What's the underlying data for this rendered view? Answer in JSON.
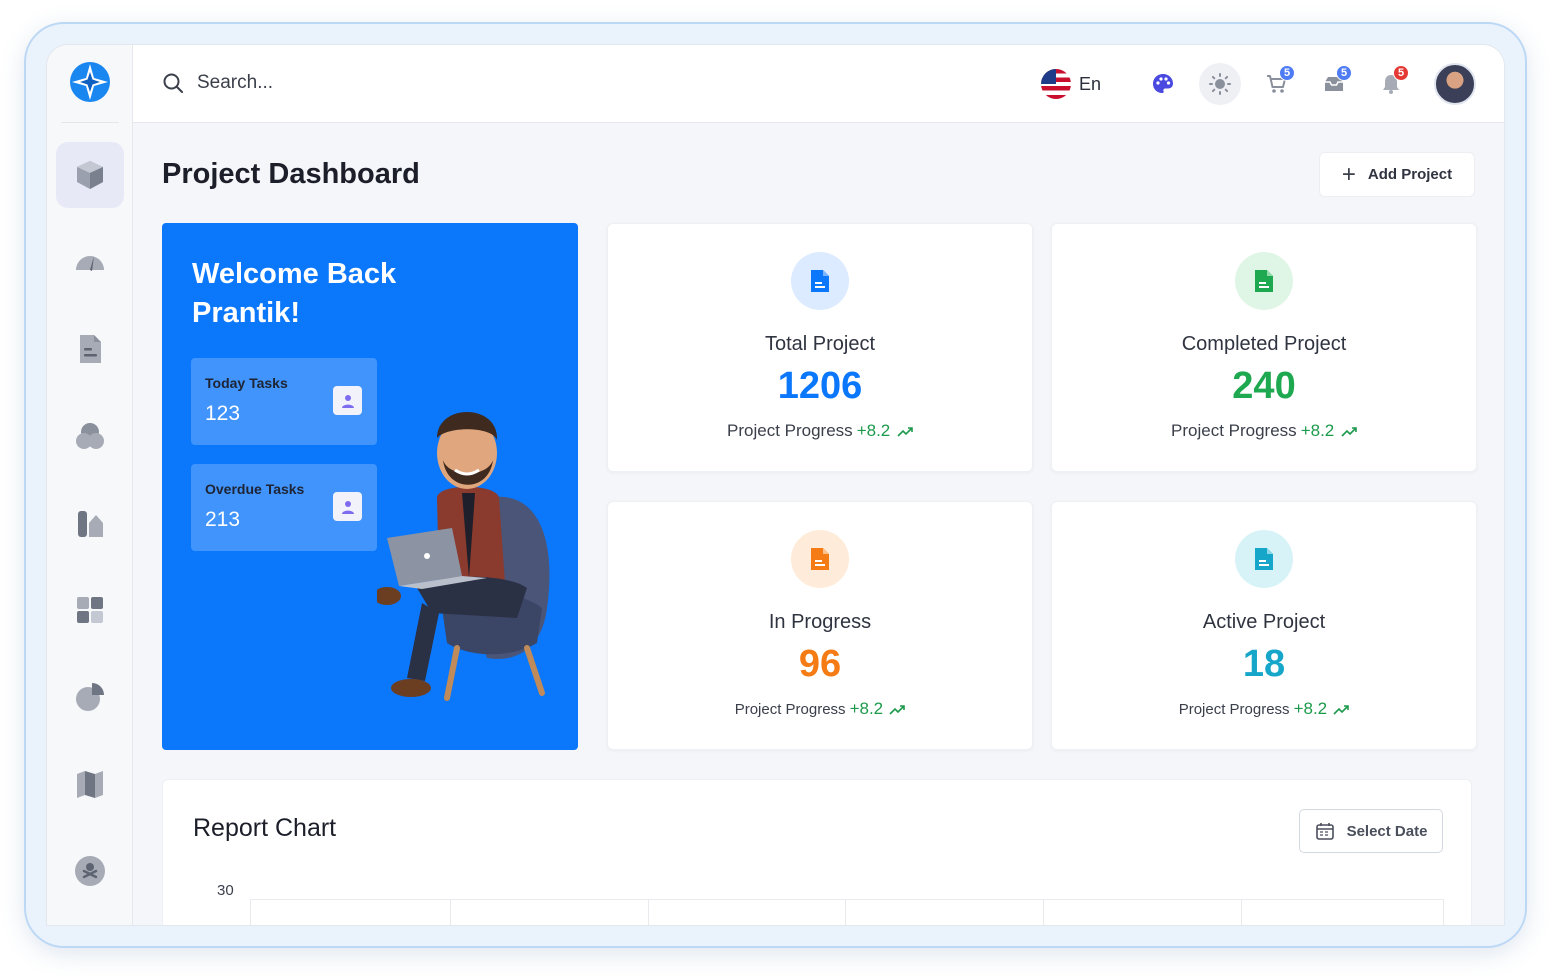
{
  "header": {
    "search_placeholder": "Search...",
    "language": "En",
    "cart_badge": "5",
    "inbox_badge": "5",
    "notifications_badge": "5"
  },
  "page": {
    "title": "Project Dashboard",
    "add_button_label": "Add Project"
  },
  "welcome": {
    "title": "Welcome Back Prantik!",
    "tasks": [
      {
        "label": "Today Tasks",
        "value": "123"
      },
      {
        "label": "Overdue Tasks",
        "value": "213"
      }
    ]
  },
  "stats": [
    {
      "label": "Total Project",
      "value": "1206",
      "progress_label": "Project Progress",
      "delta": "+8.2",
      "color": "#0b77fb",
      "icon_bg": "#dcebff"
    },
    {
      "label": "Completed Project",
      "value": "240",
      "progress_label": "Project Progress",
      "delta": "+8.2",
      "color": "#1ea84f",
      "icon_bg": "#dff6e6"
    },
    {
      "label": "In Progress",
      "value": "96",
      "progress_label": "Project Progress",
      "delta": "+8.2",
      "color": "#f57c14",
      "icon_bg": "#ffebd9"
    },
    {
      "label": "Active Project",
      "value": "18",
      "progress_label": "Project Progress",
      "delta": "+8.2",
      "color": "#15a6c9",
      "icon_bg": "#d8f3f8"
    }
  ],
  "report": {
    "title": "Report Chart",
    "date_button_label": "Select Date",
    "y_tick_top": "30"
  }
}
